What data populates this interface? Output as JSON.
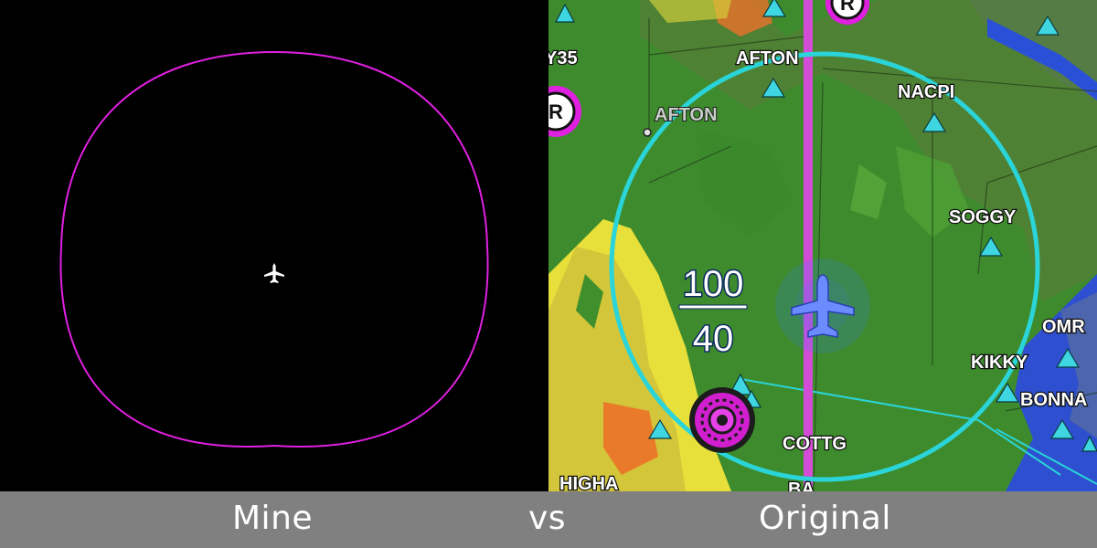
{
  "footer": {
    "left_label": "Mine",
    "middle_label": "vs",
    "right_label": "Original"
  },
  "colors": {
    "magenta": "#e020e0",
    "cyan_ring": "#2ad4d8",
    "waypoint": "#3ed6e0",
    "aircraft": "#6a8cff",
    "footer_bg": "#808080"
  },
  "map": {
    "waypoints": [
      "AFTON",
      "NACPI",
      "SOGGY",
      "KIKKY",
      "BONNA",
      "COTTG",
      "HIGHA",
      "Y35",
      "OMR",
      "BA"
    ],
    "town": "AFTON",
    "restricted_symbol": "R",
    "altitude_top": "100",
    "altitude_bottom": "40"
  },
  "icons": {
    "left_aircraft": "airplane-icon",
    "right_aircraft": "airplane-icon",
    "airport": "airport-symbol-icon",
    "waypoint": "triangle-waypoint-icon"
  }
}
